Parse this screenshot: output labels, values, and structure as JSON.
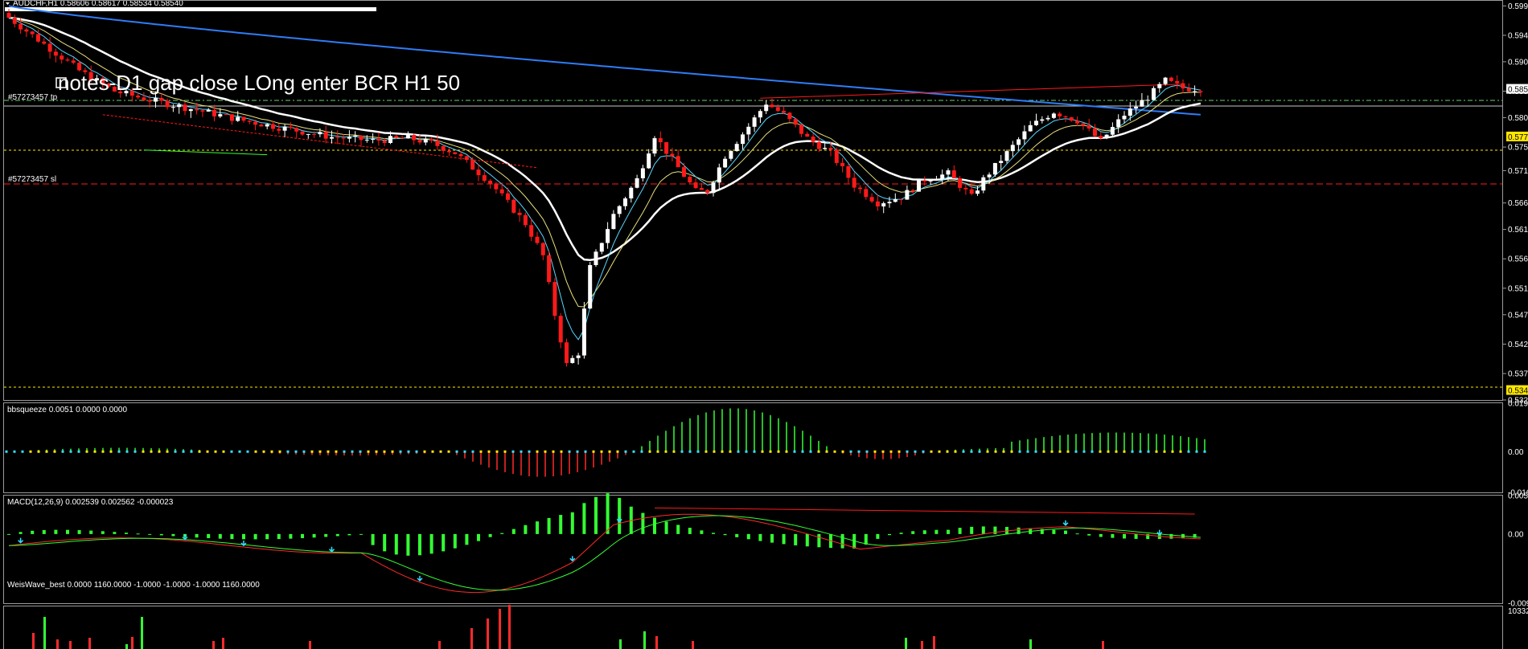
{
  "chart_header": "AUDCHF,H1  0.58606 0.58617 0.58534 0.58540",
  "note_text": "notes-D1 gap close LOng  enter BCR H1 50",
  "order_labels": {
    "tp": "#57273457 tp",
    "sl": "#57273457 sl"
  },
  "colors": {
    "bull": "#ffffff",
    "bear": "#ff1a1a",
    "ma_blue": "#2f7cf6",
    "ma_white": "#ffffff",
    "ma_yellow": "#e8e07a",
    "ma_cyan": "#55d8ff",
    "hist_green": "#33ff33",
    "hist_red": "#ff2a2a",
    "dots_cyan": "#33e0ff",
    "dots_yellow": "#ffe800",
    "trend_red": "#ff1a1a",
    "grid_green": "#6bd36b"
  },
  "chart_data": [
    {
      "type": "candlestick",
      "title": "AUDCHF,H1",
      "ylim": [
        0.5325,
        0.6005
      ],
      "y_ticks": [
        "0.599",
        "0.594",
        "0.590",
        "0.585",
        "0.580",
        "0.575",
        "0.571",
        "0.566",
        "0.561",
        "0.556",
        "0.551",
        "0.547",
        "0.542",
        "0.537",
        "0.532"
      ],
      "y_tick_values": [
        0.5995,
        0.5945,
        0.59,
        0.585,
        0.5805,
        0.5755,
        0.5715,
        0.566,
        0.5615,
        0.5565,
        0.5515,
        0.547,
        0.542,
        0.537,
        0.5325
      ],
      "price_badges": [
        {
          "label": "0.577",
          "value": 0.5773
        },
        {
          "label": "0.534",
          "value": 0.5342
        }
      ],
      "current_price": {
        "label": "0.585",
        "value": 0.5854
      },
      "levels": {
        "tp": 0.5862,
        "sl": 0.5718,
        "dashed_yellow_upper": 0.5773,
        "dashed_yellow_lower": 0.5342
      },
      "anchors": [
        [
          0,
          0.5975
        ],
        [
          6,
          0.593
        ],
        [
          12,
          0.5885
        ],
        [
          18,
          0.585
        ],
        [
          24,
          0.5835
        ],
        [
          32,
          0.5818
        ],
        [
          40,
          0.58
        ],
        [
          48,
          0.5785
        ],
        [
          55,
          0.5772
        ],
        [
          62,
          0.5766
        ],
        [
          68,
          0.577
        ],
        [
          72,
          0.5762
        ],
        [
          76,
          0.5745
        ],
        [
          82,
          0.5695
        ],
        [
          88,
          0.5625
        ],
        [
          91,
          0.557
        ],
        [
          93,
          0.547
        ],
        [
          95,
          0.5385
        ],
        [
          97,
          0.5405
        ],
        [
          99,
          0.555
        ],
        [
          103,
          0.564
        ],
        [
          107,
          0.57
        ],
        [
          110,
          0.5775
        ],
        [
          114,
          0.572
        ],
        [
          117,
          0.568
        ],
        [
          119,
          0.568
        ],
        [
          122,
          0.574
        ],
        [
          126,
          0.579
        ],
        [
          129,
          0.583
        ],
        [
          132,
          0.581
        ],
        [
          136,
          0.577
        ],
        [
          140,
          0.5745
        ],
        [
          144,
          0.569
        ],
        [
          148,
          0.566
        ],
        [
          152,
          0.567
        ],
        [
          156,
          0.57
        ],
        [
          160,
          0.571
        ],
        [
          164,
          0.567
        ],
        [
          166,
          0.57
        ],
        [
          170,
          0.5745
        ],
        [
          174,
          0.579
        ],
        [
          178,
          0.5815
        ],
        [
          182,
          0.58
        ],
        [
          186,
          0.5765
        ],
        [
          190,
          0.581
        ],
        [
          194,
          0.584
        ],
        [
          197,
          0.5868
        ],
        [
          200,
          0.5855
        ],
        [
          203,
          0.5854
        ]
      ]
    },
    {
      "type": "bar",
      "title": "bbsqueeze 0.0051 0.0000 0.0000",
      "ylim": [
        -0.016,
        0.019
      ],
      "y_ticks": [
        "0.019",
        "0.00",
        "-0.016"
      ],
      "y_tick_values": [
        0.019,
        0.0,
        -0.016
      ]
    },
    {
      "type": "line",
      "title": "MACD(12,26,9) 0.002539 0.002562 -0.000023",
      "ylim": [
        -0.009,
        0.005
      ],
      "y_ticks": [
        "0.005",
        "0.00",
        "-0.009"
      ],
      "y_tick_values": [
        0.005,
        0.0,
        -0.009
      ]
    },
    {
      "type": "bar",
      "title": "WeisWave_best 0.0000 1160.0000 -1.0000 -1.0000 -1.0000 1160.0000",
      "y_ticks": [
        "10332"
      ]
    }
  ]
}
